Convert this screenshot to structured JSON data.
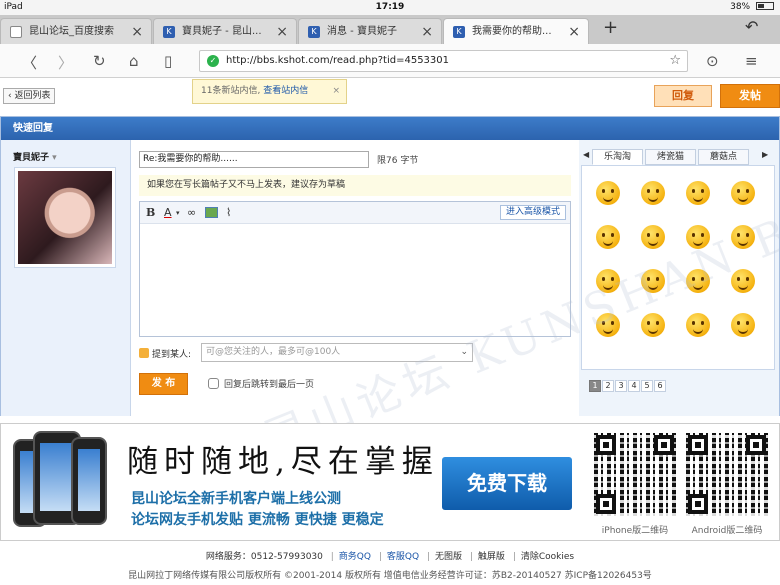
{
  "status_bar": {
    "device": "iPad",
    "time": "17:19",
    "battery": "38%"
  },
  "tabs": [
    {
      "title": "昆山论坛_百度搜索"
    },
    {
      "title": "寶貝妮子 - 昆山..."
    },
    {
      "title": "消息 - 寶貝妮子"
    },
    {
      "title": "我需要你的帮助..."
    }
  ],
  "address_bar": {
    "url": "http://bbs.kshot.com/read.php?tid=4553301"
  },
  "page": {
    "back_to_list": "返回列表",
    "notice_text": "11条新站内信,",
    "notice_link": "查看站内信",
    "reply_button": "回复",
    "post_button": "发帖"
  },
  "quick_reply": {
    "header": "快速回复",
    "username": "寶貝妮子",
    "title_value": "Re:我需要你的帮助......",
    "title_limit": "限76 字节",
    "draft_tip": "如果您在写长篇帖子又不马上发表，建议存为草稿",
    "advanced_mode": "进入高级模式",
    "mention_label": "提到某人:",
    "mention_placeholder": "可@您关注的人，最多可@100人",
    "submit_button": "发 布",
    "jump_label": "回复后跳转到最后一页",
    "watermark": "昆山论坛 KUNSHAN BBS"
  },
  "smiley_panel": {
    "tabs": [
      "乐淘淘",
      "烤瓷猫",
      "蘑菇点"
    ],
    "active_tab": 0,
    "count": 16,
    "pages": [
      "1",
      "2",
      "3",
      "4",
      "5",
      "6"
    ],
    "active_page": 0
  },
  "banner": {
    "slogan": "随时随地,尽在掌握",
    "line1": "昆山论坛全新手机客户端上线公测",
    "line2": "论坛网友手机发贴 更流畅 更快捷 更稳定",
    "download": "免费下载",
    "qr_iphone": "iPhone版二维码",
    "qr_android": "Android版二维码"
  },
  "footer": {
    "service_label": "网络服务：",
    "phone": "0512-57993030",
    "links": [
      "商务QQ",
      "客服QQ",
      "无图版",
      "触屏版",
      "清除Cookies"
    ],
    "copyright": "昆山网拉丁网络传媒有限公司版权所有 ©2001-2014 版权所有 增值电信业务经营许可证：苏B2-20140527 苏ICP备12026453号"
  }
}
